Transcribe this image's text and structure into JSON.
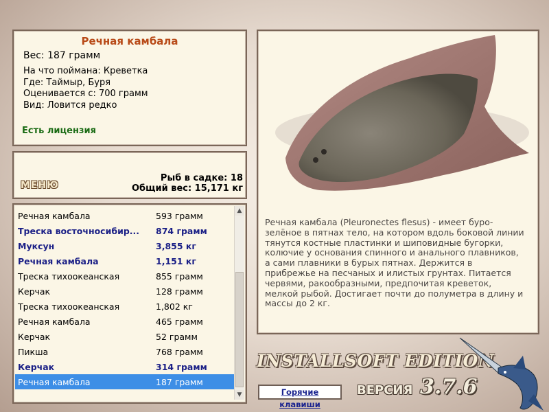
{
  "info": {
    "title": "Речная камбала",
    "weight": "Вес: 187 грамм",
    "caught_with": "На что поймана: Креветка",
    "location": "Где: Таймыр, Буря",
    "value": "Оценивается с: 700 грамм",
    "rarity": "Вид: Ловится редко",
    "license": "Есть лицензия"
  },
  "stats": {
    "menu_label": "МЕНЮ",
    "fish_in_net": "Рыб в садке: 18",
    "total_weight": "Общий вес: 15,171 кг"
  },
  "catch_list": [
    {
      "name": "Речная камбала",
      "weight": "593 грамм",
      "bold": false,
      "selected": false
    },
    {
      "name": "Треска восточносибир...",
      "weight": "874 грамм",
      "bold": true,
      "selected": false
    },
    {
      "name": "Муксун",
      "weight": "3,855 кг",
      "bold": true,
      "selected": false
    },
    {
      "name": "Речная камбала",
      "weight": "1,151 кг",
      "bold": true,
      "selected": false
    },
    {
      "name": "Треска тихоокеанская",
      "weight": "855 грамм",
      "bold": false,
      "selected": false
    },
    {
      "name": "Керчак",
      "weight": "128 грамм",
      "bold": false,
      "selected": false
    },
    {
      "name": "Треска тихоокеанская",
      "weight": "1,802 кг",
      "bold": false,
      "selected": false
    },
    {
      "name": "Речная камбала",
      "weight": "465 грамм",
      "bold": false,
      "selected": false
    },
    {
      "name": "Керчак",
      "weight": "52 грамм",
      "bold": false,
      "selected": false
    },
    {
      "name": "Пикша",
      "weight": "768 грамм",
      "bold": false,
      "selected": false
    },
    {
      "name": "Керчак",
      "weight": "314 грамм",
      "bold": true,
      "selected": false
    },
    {
      "name": "Речная камбала",
      "weight": "187 грамм",
      "bold": false,
      "selected": true
    }
  ],
  "detail": {
    "description": "Речная камбала (Pleuronectes flesus) - имеет буро-зелёное в пятнах тело, на котором вдоль боковой линии тянутся костные пластинки и шиповидные бугорки, колючие у основания спинного и анального плавников, а сами плавники в бурых пятнах. Держится в прибрежье на песчаных и илистых грунтах. Питается червями, ракообразными, предпочитая креветок, мелкой рыбой. Достигает почти до полуметра в длину и массы до 2 кг."
  },
  "branding": {
    "edition": "INSTALLSOFT EDITION",
    "version_word": "ВЕРСИЯ",
    "version_number": "3.7.6"
  },
  "hotkeys_label": "Горячие клавиши",
  "colors": {
    "title": "#b84a18",
    "license": "#1a6b14",
    "bold_row": "#1a1f86",
    "selection": "#3d8ee6"
  }
}
